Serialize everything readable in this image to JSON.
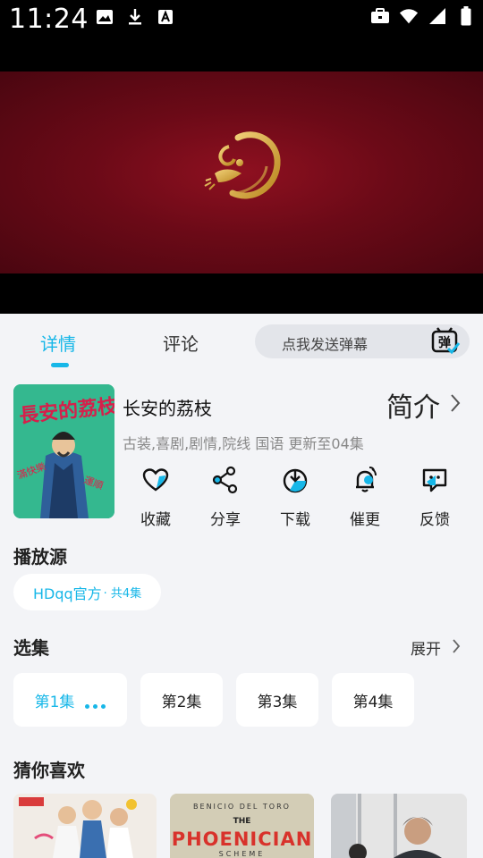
{
  "status_bar": {
    "time": "11:24",
    "left_icons": [
      "image-icon",
      "download-icon",
      "font-icon"
    ],
    "right_icons": [
      "briefcase-icon",
      "wifi-icon",
      "signal-icon",
      "battery-icon"
    ]
  },
  "tabs": {
    "details": "详情",
    "comments": "评论",
    "danmaku_placeholder": "点我发送弹幕",
    "danmaku_icon_text": "弹"
  },
  "show": {
    "title": "长安的荔枝",
    "intro_label": "简介",
    "tags": "古装,喜剧,剧情,院线 国语 更新至04集",
    "poster_text": "長安的荔枝"
  },
  "actions": [
    {
      "label": "收藏",
      "icon": "heart-icon"
    },
    {
      "label": "分享",
      "icon": "share-icon"
    },
    {
      "label": "下载",
      "icon": "download-circle-icon"
    },
    {
      "label": "催更",
      "icon": "bell-icon"
    },
    {
      "label": "反馈",
      "icon": "feedback-icon"
    }
  ],
  "source": {
    "section_title": "播放源",
    "name": "HDqq官方",
    "count": " · 共4集"
  },
  "episodes": {
    "section_title": "选集",
    "expand_label": "展开",
    "items": [
      "第1集",
      "第2集",
      "第3集",
      "第4集"
    ],
    "active_index": 0
  },
  "recommend": {
    "section_title": "猜你喜欢",
    "cards": [
      {
        "text": ""
      },
      {
        "top_text": "BENICIO DEL TORO",
        "the": "THE",
        "title": "PHOENICIAN",
        "sub": "SCHEME"
      },
      {
        "text": ""
      }
    ]
  },
  "colors": {
    "accent": "#17b7e8",
    "page_bg": "#f3f4f7",
    "video_red": "#7a0c1a",
    "logo_gold": "#d4a93a"
  }
}
